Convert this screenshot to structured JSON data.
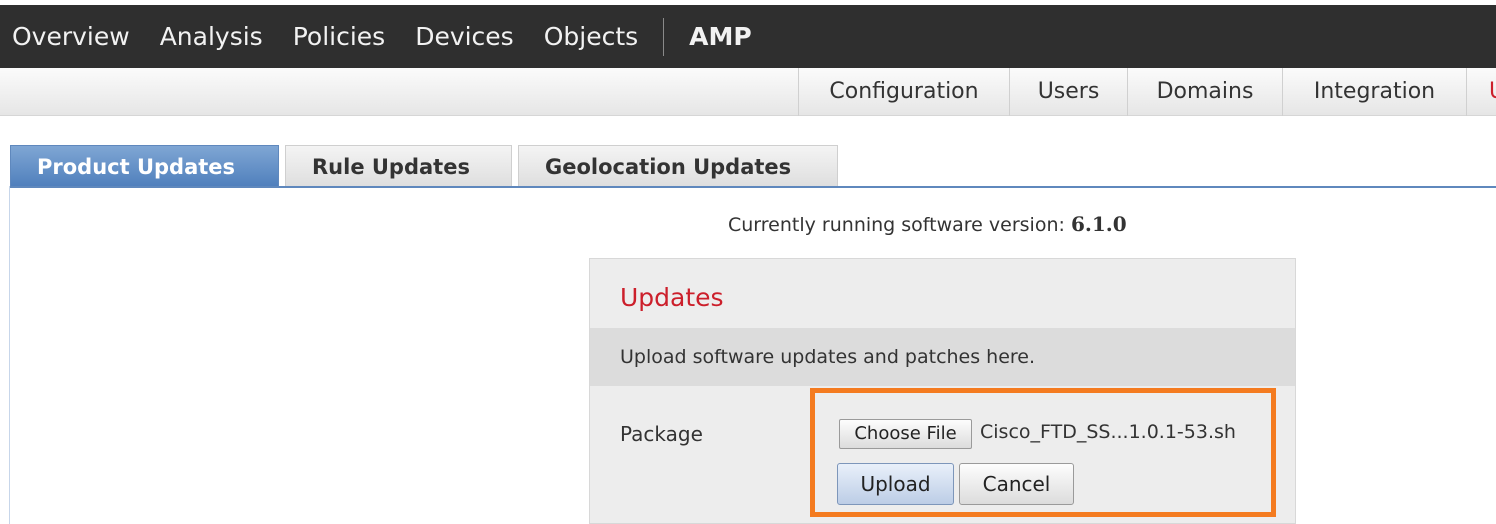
{
  "top_nav": {
    "items": [
      "Overview",
      "Analysis",
      "Policies",
      "Devices",
      "Objects"
    ],
    "extra": "AMP"
  },
  "sub_nav": {
    "items": [
      "Configuration",
      "Users",
      "Domains",
      "Integration"
    ],
    "cut_item": "U"
  },
  "tabs": [
    "Product Updates",
    "Rule Updates",
    "Geolocation Updates"
  ],
  "version": {
    "label": "Currently running software version:",
    "value": "6.1.0"
  },
  "updates_panel": {
    "title": "Updates",
    "description": "Upload software updates and patches here.",
    "package_label": "Package",
    "choose_file_button": "Choose File",
    "filename": "Cisco_FTD_SS...1.0.1-53.sh",
    "upload_button": "Upload",
    "cancel_button": "Cancel"
  },
  "colors": {
    "top_nav_bg": "#2f2f2f",
    "active_tab": "#5f88bd",
    "title_red": "#cc1f2b",
    "highlight_orange": "#f47b20"
  }
}
